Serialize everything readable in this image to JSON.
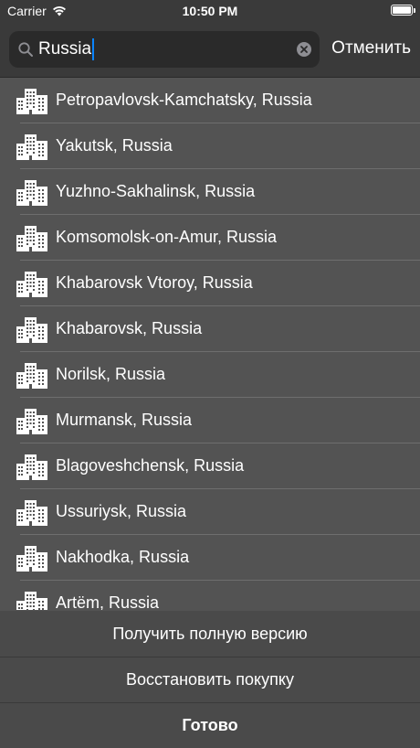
{
  "status_bar": {
    "carrier": "Carrier",
    "time": "10:50 PM",
    "battery_level": 1.0
  },
  "search": {
    "query": "Russia",
    "cancel_label": "Отменить",
    "search_icon": "magnifier-icon",
    "clear_icon": "clear-circle-icon"
  },
  "results": [
    "Petropavlovsk-Kamchatsky, Russia",
    "Yakutsk, Russia",
    "Yuzhno-Sakhalinsk, Russia",
    "Komsomolsk-on-Amur, Russia",
    "Khabarovsk Vtoroy, Russia",
    "Khabarovsk, Russia",
    "Norilsk, Russia",
    "Murmansk, Russia",
    "Blagoveshchensk, Russia",
    "Ussuriysk, Russia",
    "Nakhodka, Russia",
    "Artëm, Russia"
  ],
  "action_sheet": {
    "full_version_label": "Получить полную версию",
    "restore_label": "Восстановить покупку",
    "done_label": "Готово"
  },
  "colors": {
    "background": "#535353",
    "header": "#3a3a3a",
    "search_field": "#2a2a2a",
    "caret": "#0a84ff"
  }
}
